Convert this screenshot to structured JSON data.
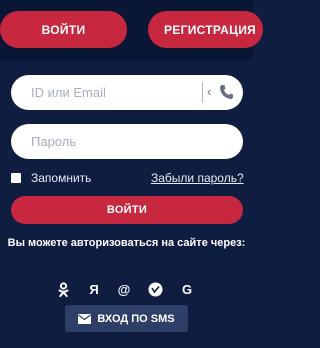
{
  "header": {
    "login_tab": "ВОЙТИ",
    "register_tab": "РЕГИСТРАЦИЯ"
  },
  "form": {
    "id_placeholder": "ID или Email",
    "id_value": "",
    "password_placeholder": "Пароль",
    "password_value": "",
    "remember_label": "Запомнить",
    "remember_checked": false,
    "forgot_label": "Забыли пароль?",
    "submit_label": "ВОЙТИ"
  },
  "social": {
    "prompt": "Вы можете авторизоваться на сайте через:",
    "providers": [
      "odnoklassniki-icon",
      "yandex-icon",
      "mail-ru-icon",
      "vk-icon",
      "google-icon"
    ],
    "sms_label": "ВХОД ПО SMS"
  },
  "colors": {
    "background": "#0f1d40",
    "accent": "#c8283f",
    "sms_button": "#2d3f66"
  }
}
